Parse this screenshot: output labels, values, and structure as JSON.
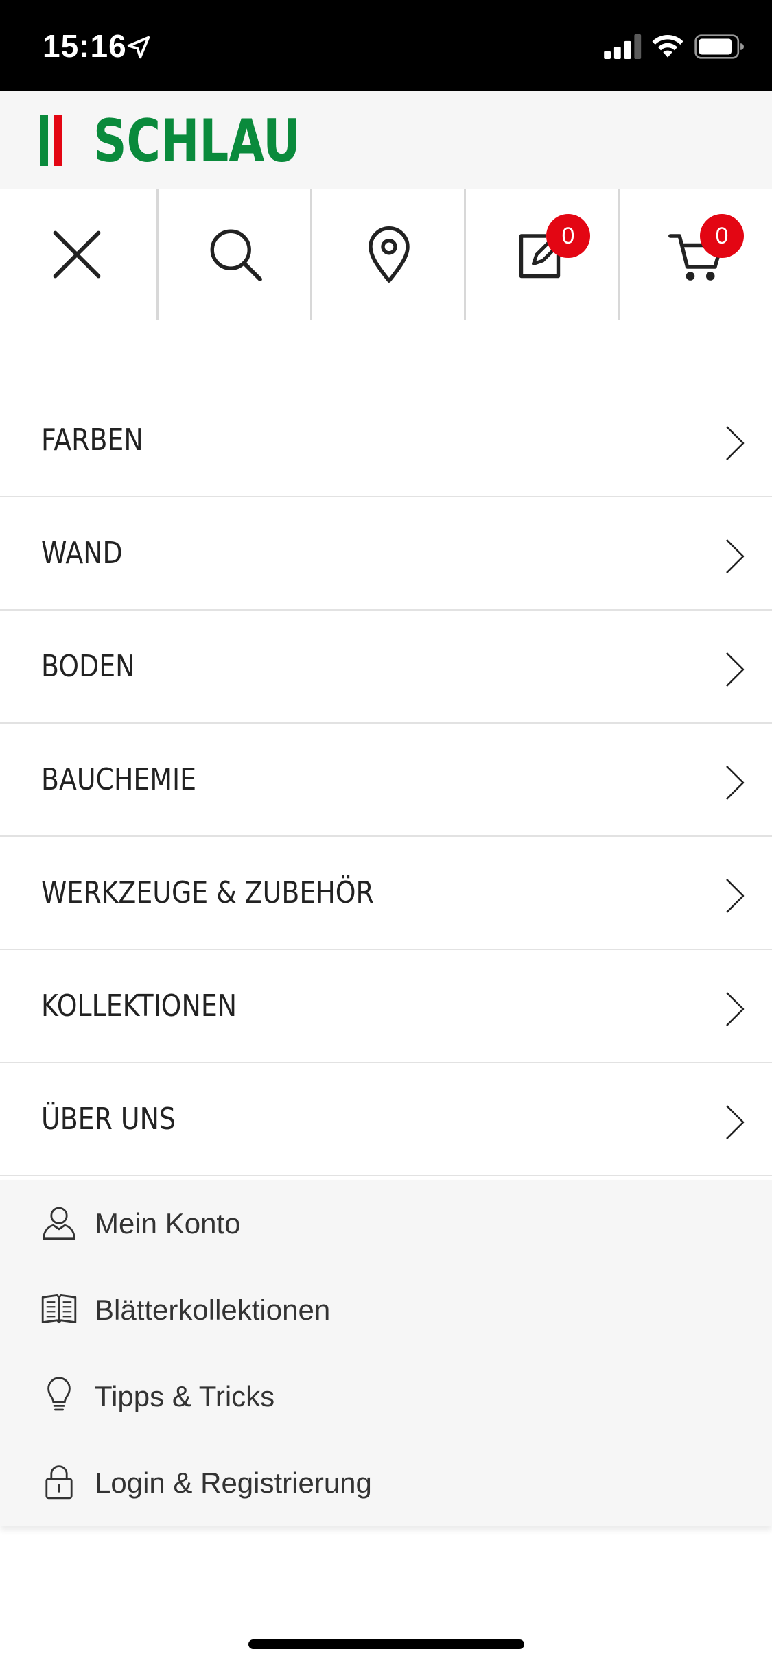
{
  "status_bar": {
    "time": "15:16",
    "location_icon": "location-arrow-icon",
    "signal_icon": "cellular-signal-icon",
    "wifi_icon": "wifi-icon",
    "battery_icon": "battery-icon"
  },
  "brand": {
    "name": "SCHLAU",
    "primary_color": "#0a8a3c",
    "accent_color": "#e30613"
  },
  "toolbar": {
    "close_icon": "close-icon",
    "search_icon": "search-icon",
    "store_locator_icon": "map-pin-icon",
    "notepad_icon": "edit-note-icon",
    "notepad_count": "0",
    "cart_icon": "shopping-cart-icon",
    "cart_count": "0"
  },
  "menu": {
    "items": [
      {
        "label": "FARBEN"
      },
      {
        "label": "WAND"
      },
      {
        "label": "BODEN"
      },
      {
        "label": "BAUCHEMIE"
      },
      {
        "label": "WERKZEUGE & ZUBEHÖR"
      },
      {
        "label": "KOLLEKTIONEN"
      },
      {
        "label": "ÜBER UNS"
      }
    ],
    "chevron_icon": "chevron-right-icon"
  },
  "secondary": {
    "items": [
      {
        "label": "Mein Konto",
        "icon": "user-icon"
      },
      {
        "label": "Blätterkollektionen",
        "icon": "book-open-icon"
      },
      {
        "label": "Tipps & Tricks",
        "icon": "lightbulb-icon"
      },
      {
        "label": "Login & Registrierung",
        "icon": "lock-icon"
      }
    ]
  }
}
